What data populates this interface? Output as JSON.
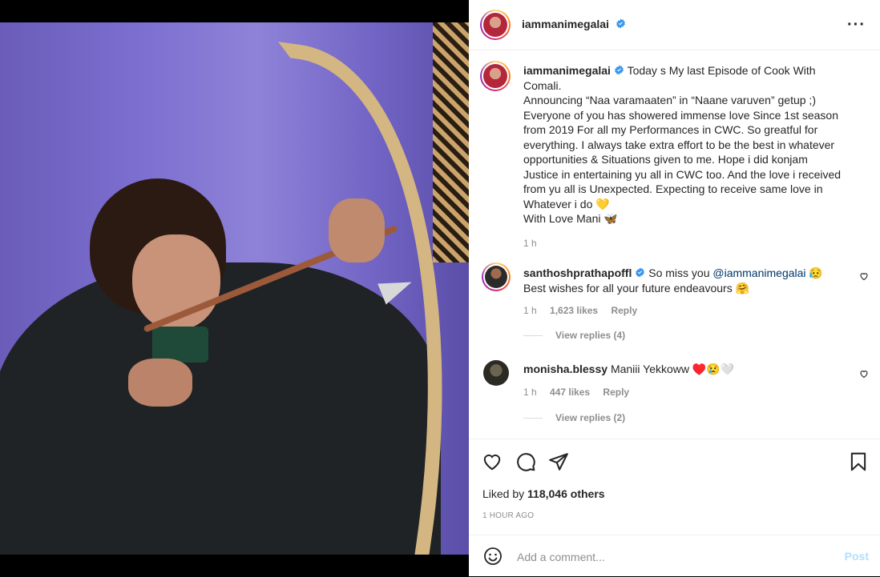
{
  "post": {
    "author": "iammanimegalai",
    "caption_lines": [
      "Today s My last Episode of Cook With",
      "Comali.",
      "Announcing “Naa varamaaten” in “Naane varuven” getup ;)",
      "Everyone of you has showered immense love Since 1st season",
      "from 2019 For all my Performances in CWC. So greatful for",
      "everything. I always take extra effort to be the best in whatever",
      "opportunities & Situations given to me. Hope i did konjam",
      "Justice in entertaining yu all in CWC too. And the love i received",
      "from yu all is Unexpected. Expecting to receive same love in",
      "Whatever i do 💛",
      "With Love Mani 🦋"
    ],
    "caption_time": "1 h",
    "likes_prefix": "Liked by",
    "likes_count": "118,046 others",
    "timestamp": "1 HOUR AGO"
  },
  "comments": [
    {
      "user": "santhoshprathapoffl",
      "text_before": "So miss you",
      "mention": "@iammanimegalai",
      "text_after": "😥",
      "line2": "Best wishes for all your future endeavours 🤗",
      "time": "1 h",
      "likes": "1,623 likes",
      "reply": "Reply",
      "view_replies": "View replies (4)"
    },
    {
      "user": "monisha.blessy",
      "text": "Maniii Yekkoww ♥️😢🤍",
      "time": "1 h",
      "likes": "447 likes",
      "reply": "Reply",
      "view_replies": "View replies (2)"
    }
  ],
  "composer": {
    "placeholder": "Add a comment...",
    "post_label": "Post"
  },
  "icons": {
    "more": "more-options-icon",
    "like": "heart-icon",
    "comment": "comment-icon",
    "share": "share-icon",
    "save": "bookmark-icon",
    "emoji": "emoji-icon"
  },
  "colors": {
    "verified": "#3897f0",
    "mention": "#00376b",
    "post_disabled": "#b2dffc",
    "muted": "#8e8e8e"
  }
}
